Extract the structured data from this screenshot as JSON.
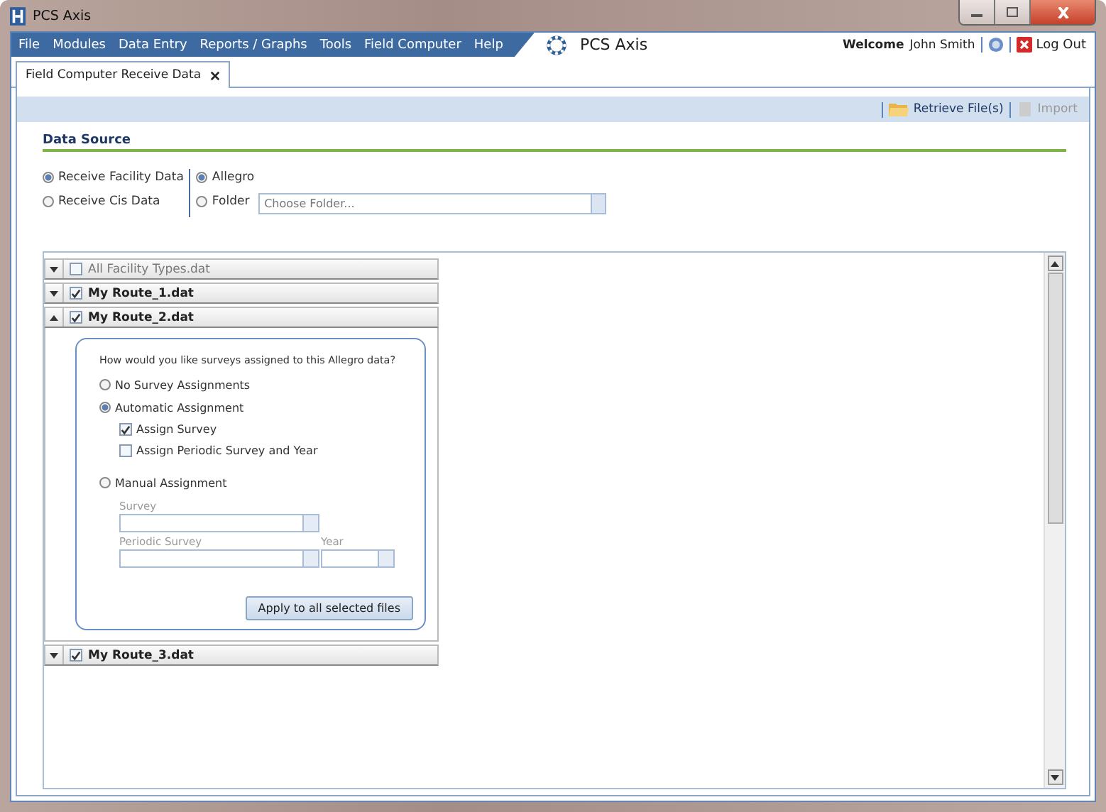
{
  "window": {
    "title": "PCS Axis"
  },
  "menu": [
    "File",
    "Modules",
    "Data Entry",
    "Reports / Graphs",
    "Tools",
    "Field Computer",
    "Help"
  ],
  "brand": "PCS Axis",
  "user": {
    "welcome": "Welcome",
    "name": "John Smith",
    "logout": "Log Out"
  },
  "tabs": [
    {
      "label": "Field Computer Receive Data",
      "selected": true
    }
  ],
  "toolbar": [
    {
      "label": "Retrieve File(s)",
      "kind": "folder",
      "disabled": false
    },
    {
      "label": "Import",
      "kind": "import",
      "disabled": true
    }
  ],
  "section_title": "Data Source",
  "source_options": [
    {
      "label": "Receive Facility Data",
      "selected": true
    },
    {
      "label": "Receive Cis Data",
      "selected": false
    }
  ],
  "device_options": [
    {
      "label": "Allegro",
      "selected": true
    },
    {
      "label": "Folder",
      "selected": false
    }
  ],
  "folder_field": {
    "placeholder": "Choose Folder..."
  },
  "files": [
    {
      "name": "All Facility Types.dat",
      "checked": false,
      "expanded": false
    },
    {
      "name": "My Route_1.dat",
      "checked": true,
      "expanded": false
    },
    {
      "name": "My Route_2.dat",
      "checked": true,
      "expanded": true
    },
    {
      "name": "My Route_3.dat",
      "checked": true,
      "expanded": false
    }
  ],
  "assign_panel": {
    "question": "How would you like surveys assigned to this Allegro data?",
    "options": [
      {
        "kind": "radio",
        "label": "No Survey Assignments",
        "selected": false
      },
      {
        "kind": "radio",
        "label": "Automatic Assignment",
        "selected": true
      },
      {
        "kind": "checkbox",
        "label": "Assign Survey",
        "checked": true
      },
      {
        "kind": "checkbox",
        "label": "Assign Periodic Survey and Year",
        "checked": false
      },
      {
        "kind": "radio",
        "label": "Manual Assignment",
        "selected": false
      }
    ],
    "survey_label": "Survey",
    "periodic_label": "Periodic Survey",
    "year_label": "Year",
    "apply_button": "Apply to all selected files"
  }
}
